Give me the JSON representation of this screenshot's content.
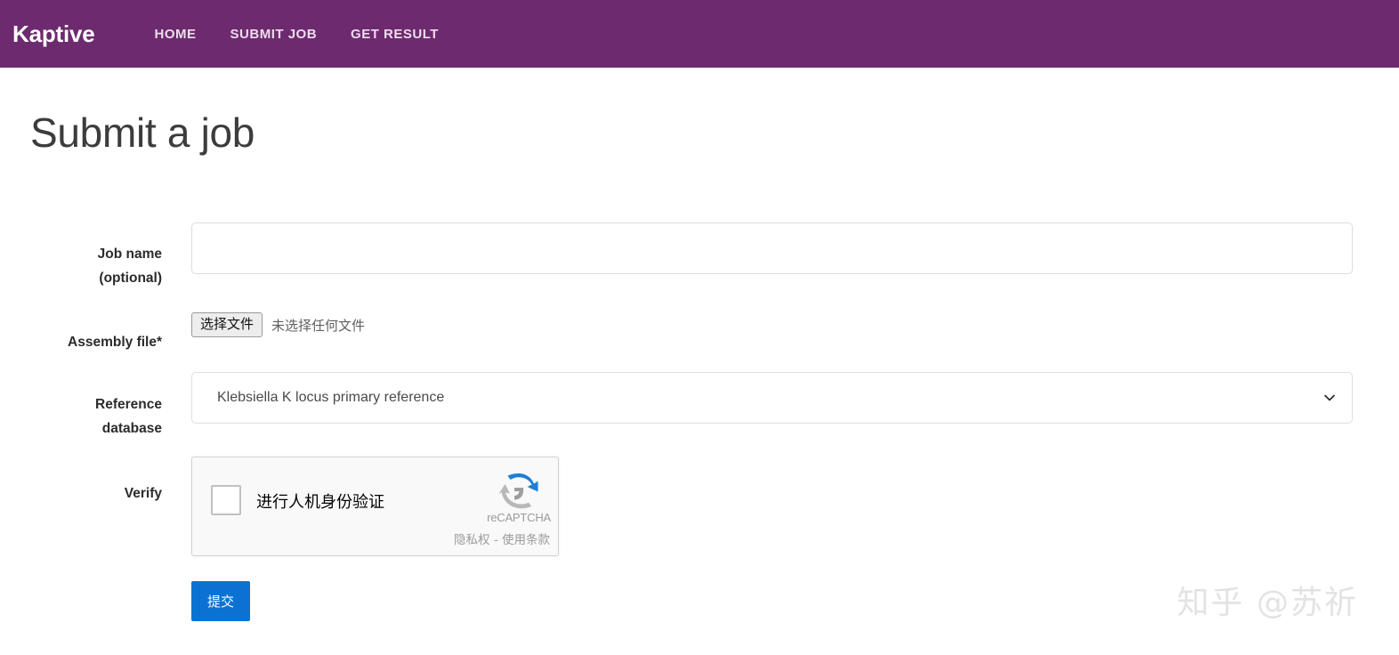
{
  "header": {
    "brand": "Kaptive",
    "brand_color": "#6d2a6e",
    "nav_link_color": "#eddcee",
    "nav": [
      {
        "label": "HOME",
        "name": "nav-home"
      },
      {
        "label": "SUBMIT JOB",
        "name": "nav-submit-job"
      },
      {
        "label": "GET RESULT",
        "name": "nav-get-result"
      }
    ]
  },
  "page": {
    "title": "Submit a job"
  },
  "form": {
    "job_name": {
      "label_line1": "Job name",
      "label_line2": "(optional)",
      "value": "",
      "placeholder": ""
    },
    "assembly_file": {
      "label": "Assembly file*",
      "button_label": "选择文件",
      "status_text": "未选择任何文件"
    },
    "reference_database": {
      "label_line1": "Reference",
      "label_line2": "database",
      "selected": "Klebsiella K locus primary reference",
      "chevron_icon": "chevron-down-icon"
    },
    "verify": {
      "label": "Verify",
      "checkbox_label": "进行人机身份验证",
      "brand": "reCAPTCHA",
      "privacy": "隐私权",
      "separator": "-",
      "terms": "使用条款",
      "logo_icon": "recaptcha-logo-icon"
    },
    "submit": {
      "label": "提交",
      "color": "#0b72d4"
    }
  },
  "watermark": {
    "text": "知乎 @苏祈"
  }
}
